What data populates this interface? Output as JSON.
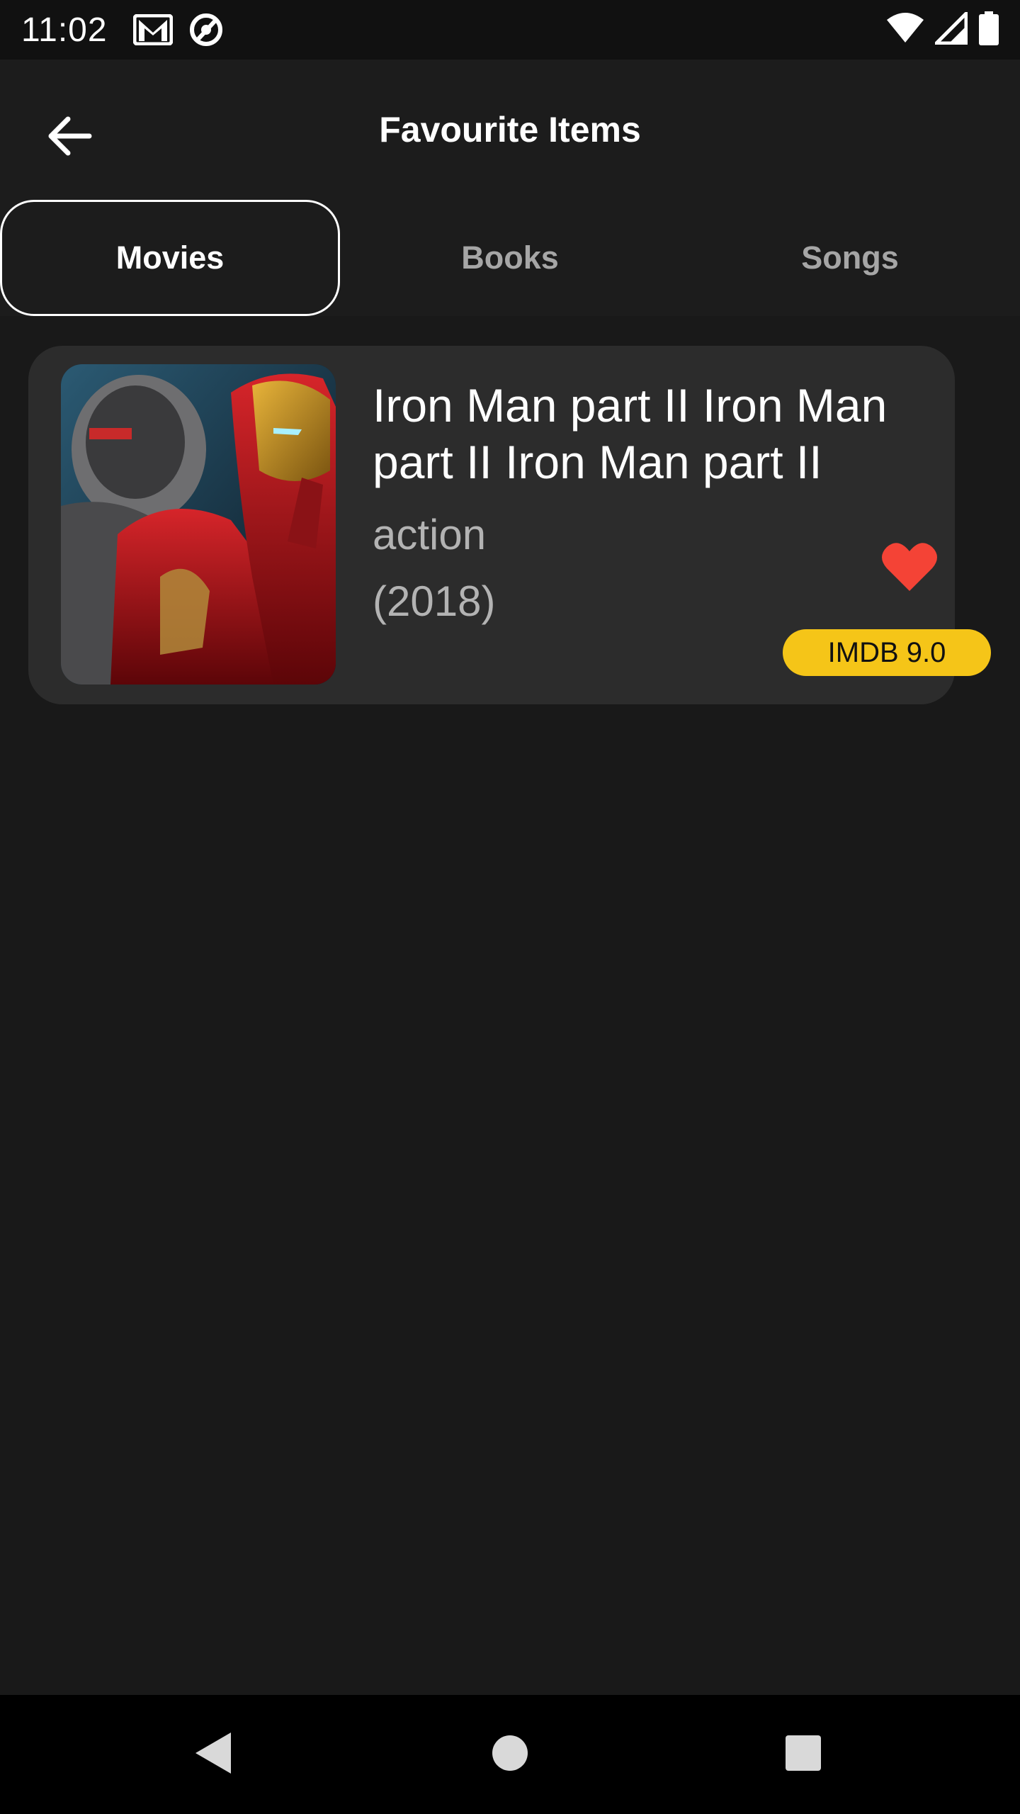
{
  "status_bar": {
    "time": "11:02",
    "icons": [
      "gmail-icon",
      "sync-icon",
      "wifi-icon",
      "signal-icon",
      "battery-icon"
    ]
  },
  "app_bar": {
    "title": "Favourite Items",
    "back_icon": "arrow-left-icon"
  },
  "tabs": [
    {
      "label": "Movies",
      "active": true
    },
    {
      "label": "Books",
      "active": false
    },
    {
      "label": "Songs",
      "active": false
    }
  ],
  "favorites": [
    {
      "title": "Iron Man part II Iron Man part II Iron Man part II",
      "genre": "action",
      "year": "(2018)",
      "rating": "IMDB 9.0",
      "favorited": true,
      "poster_icon": "movie-poster-image"
    }
  ],
  "colors": {
    "background": "#191919",
    "card": "#2c2c2c",
    "heart": "#f44336",
    "imdb": "#f5c518"
  },
  "nav_bar": {
    "icons": [
      "back-triangle-icon",
      "home-circle-icon",
      "recents-square-icon"
    ]
  }
}
